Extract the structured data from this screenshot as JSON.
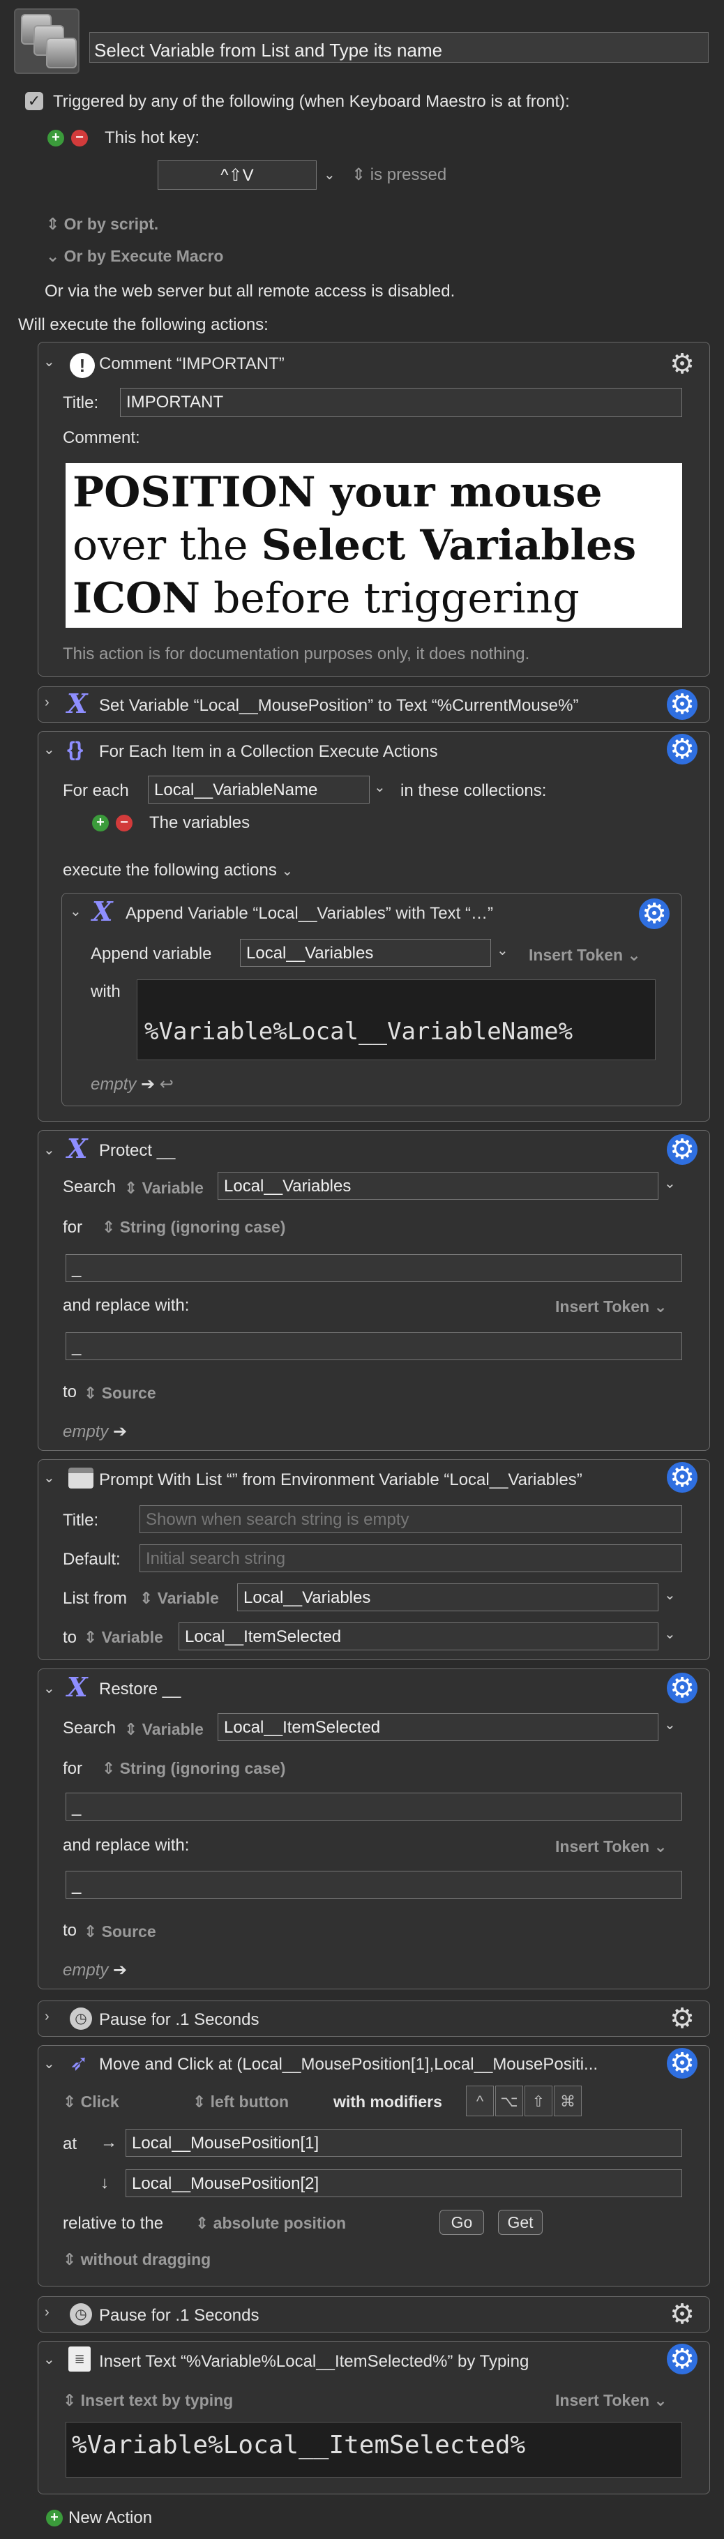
{
  "macro": {
    "title": "Select Variable from List and Type its name",
    "trigger_text": "Triggered by any of the following (when Keyboard Maestro is at front):",
    "hotkey_label": "This hot key:",
    "hotkey_value": "^⇧V",
    "hotkey_mode": "is pressed",
    "or_by_script": "Or by script.",
    "or_by_execute": "Or by Execute Macro",
    "web_server_note": "Or via the web server but all remote access is disabled.",
    "will_execute": "Will execute the following actions:",
    "new_action": "New Action"
  },
  "actions": {
    "comment": {
      "header": "Comment “IMPORTANT”",
      "title_label": "Title:",
      "title_value": "IMPORTANT",
      "comment_label": "Comment:",
      "text_part1_bold": "POSITION your mouse",
      "text_part2": " over the ",
      "text_part3_bold": "Select Variables ICON",
      "text_part4": " before triggering",
      "doc_note": "This action is for documentation purposes only, it does nothing."
    },
    "set_variable": {
      "header": "Set Variable “Local__MousePosition” to Text “%CurrentMouse%”"
    },
    "for_each": {
      "header": "For Each Item in a Collection Execute Actions",
      "for_each_label": "For each",
      "variable": "Local__VariableName",
      "in_collections": "in these collections:",
      "collection": "The variables",
      "execute_label": "execute the following actions",
      "append": {
        "header": "Append Variable “Local__Variables” with Text “…”",
        "append_label": "Append variable",
        "variable": "Local__Variables",
        "insert_token": "Insert Token",
        "with_label": "with",
        "text": "%Variable%Local__VariableName%",
        "empty_label": "empty"
      }
    },
    "protect": {
      "header": "Protect __",
      "search_label": "Search",
      "source_type": "Variable",
      "variable": "Local__Variables",
      "for_label": "for",
      "match_mode": "String (ignoring case)",
      "search_text": "_",
      "replace_label": "and replace with:",
      "insert_token": "Insert Token",
      "replace_text": "_",
      "to_label": "to",
      "to_value": "Source",
      "empty_label": "empty"
    },
    "prompt": {
      "header": "Prompt With List “” from Environment Variable “Local__Variables”",
      "title_label": "Title:",
      "title_placeholder": "Shown when search string is empty",
      "default_label": "Default:",
      "default_placeholder": "Initial search string",
      "list_from_label": "List from",
      "list_source_type": "Variable",
      "list_variable": "Local__Variables",
      "to_label": "to",
      "to_type": "Variable",
      "to_variable": "Local__ItemSelected"
    },
    "restore": {
      "header": "Restore __",
      "search_label": "Search",
      "source_type": "Variable",
      "variable": "Local__ItemSelected",
      "for_label": "for",
      "match_mode": "String (ignoring case)",
      "search_text": "_",
      "replace_label": "and replace with:",
      "insert_token": "Insert Token",
      "replace_text": "_",
      "to_label": "to",
      "to_value": "Source",
      "empty_label": "empty"
    },
    "pause1": {
      "header": "Pause for .1 Seconds"
    },
    "move_click": {
      "header": "Move and Click at (Local__MousePosition[1],Local__MousePositi...",
      "click_type": "Click",
      "button": "left button",
      "modifiers_label": "with modifiers",
      "modifier_keys": [
        "^",
        "⌥",
        "⇧",
        "⌘"
      ],
      "at_label": "at",
      "x_value": "Local__MousePosition[1]",
      "y_value": "Local__MousePosition[2]",
      "relative_label": "relative to the",
      "relative_mode": "absolute position",
      "go_button": "Go",
      "get_button": "Get",
      "drag_mode": "without dragging"
    },
    "pause2": {
      "header": "Pause for .1 Seconds"
    },
    "insert_text": {
      "header": "Insert Text “%Variable%Local__ItemSelected%” by Typing",
      "mode": "Insert text by typing",
      "insert_token": "Insert Token",
      "text": "%Variable%Local__ItemSelected%"
    }
  },
  "icons": {
    "gear": "gear-icon",
    "chevron_down": "chevron-down-icon",
    "chevron_right": "chevron-right-icon",
    "variable": "variable-x-icon",
    "updown": "updown-arrows-icon",
    "return": "return-arrow-icon"
  },
  "colors": {
    "background": "#2b2b2b",
    "gear_blue": "#2f6fe0",
    "variable_icon": "#8e8eff",
    "plus": "#3b9b3b",
    "minus": "#d23b3b"
  }
}
